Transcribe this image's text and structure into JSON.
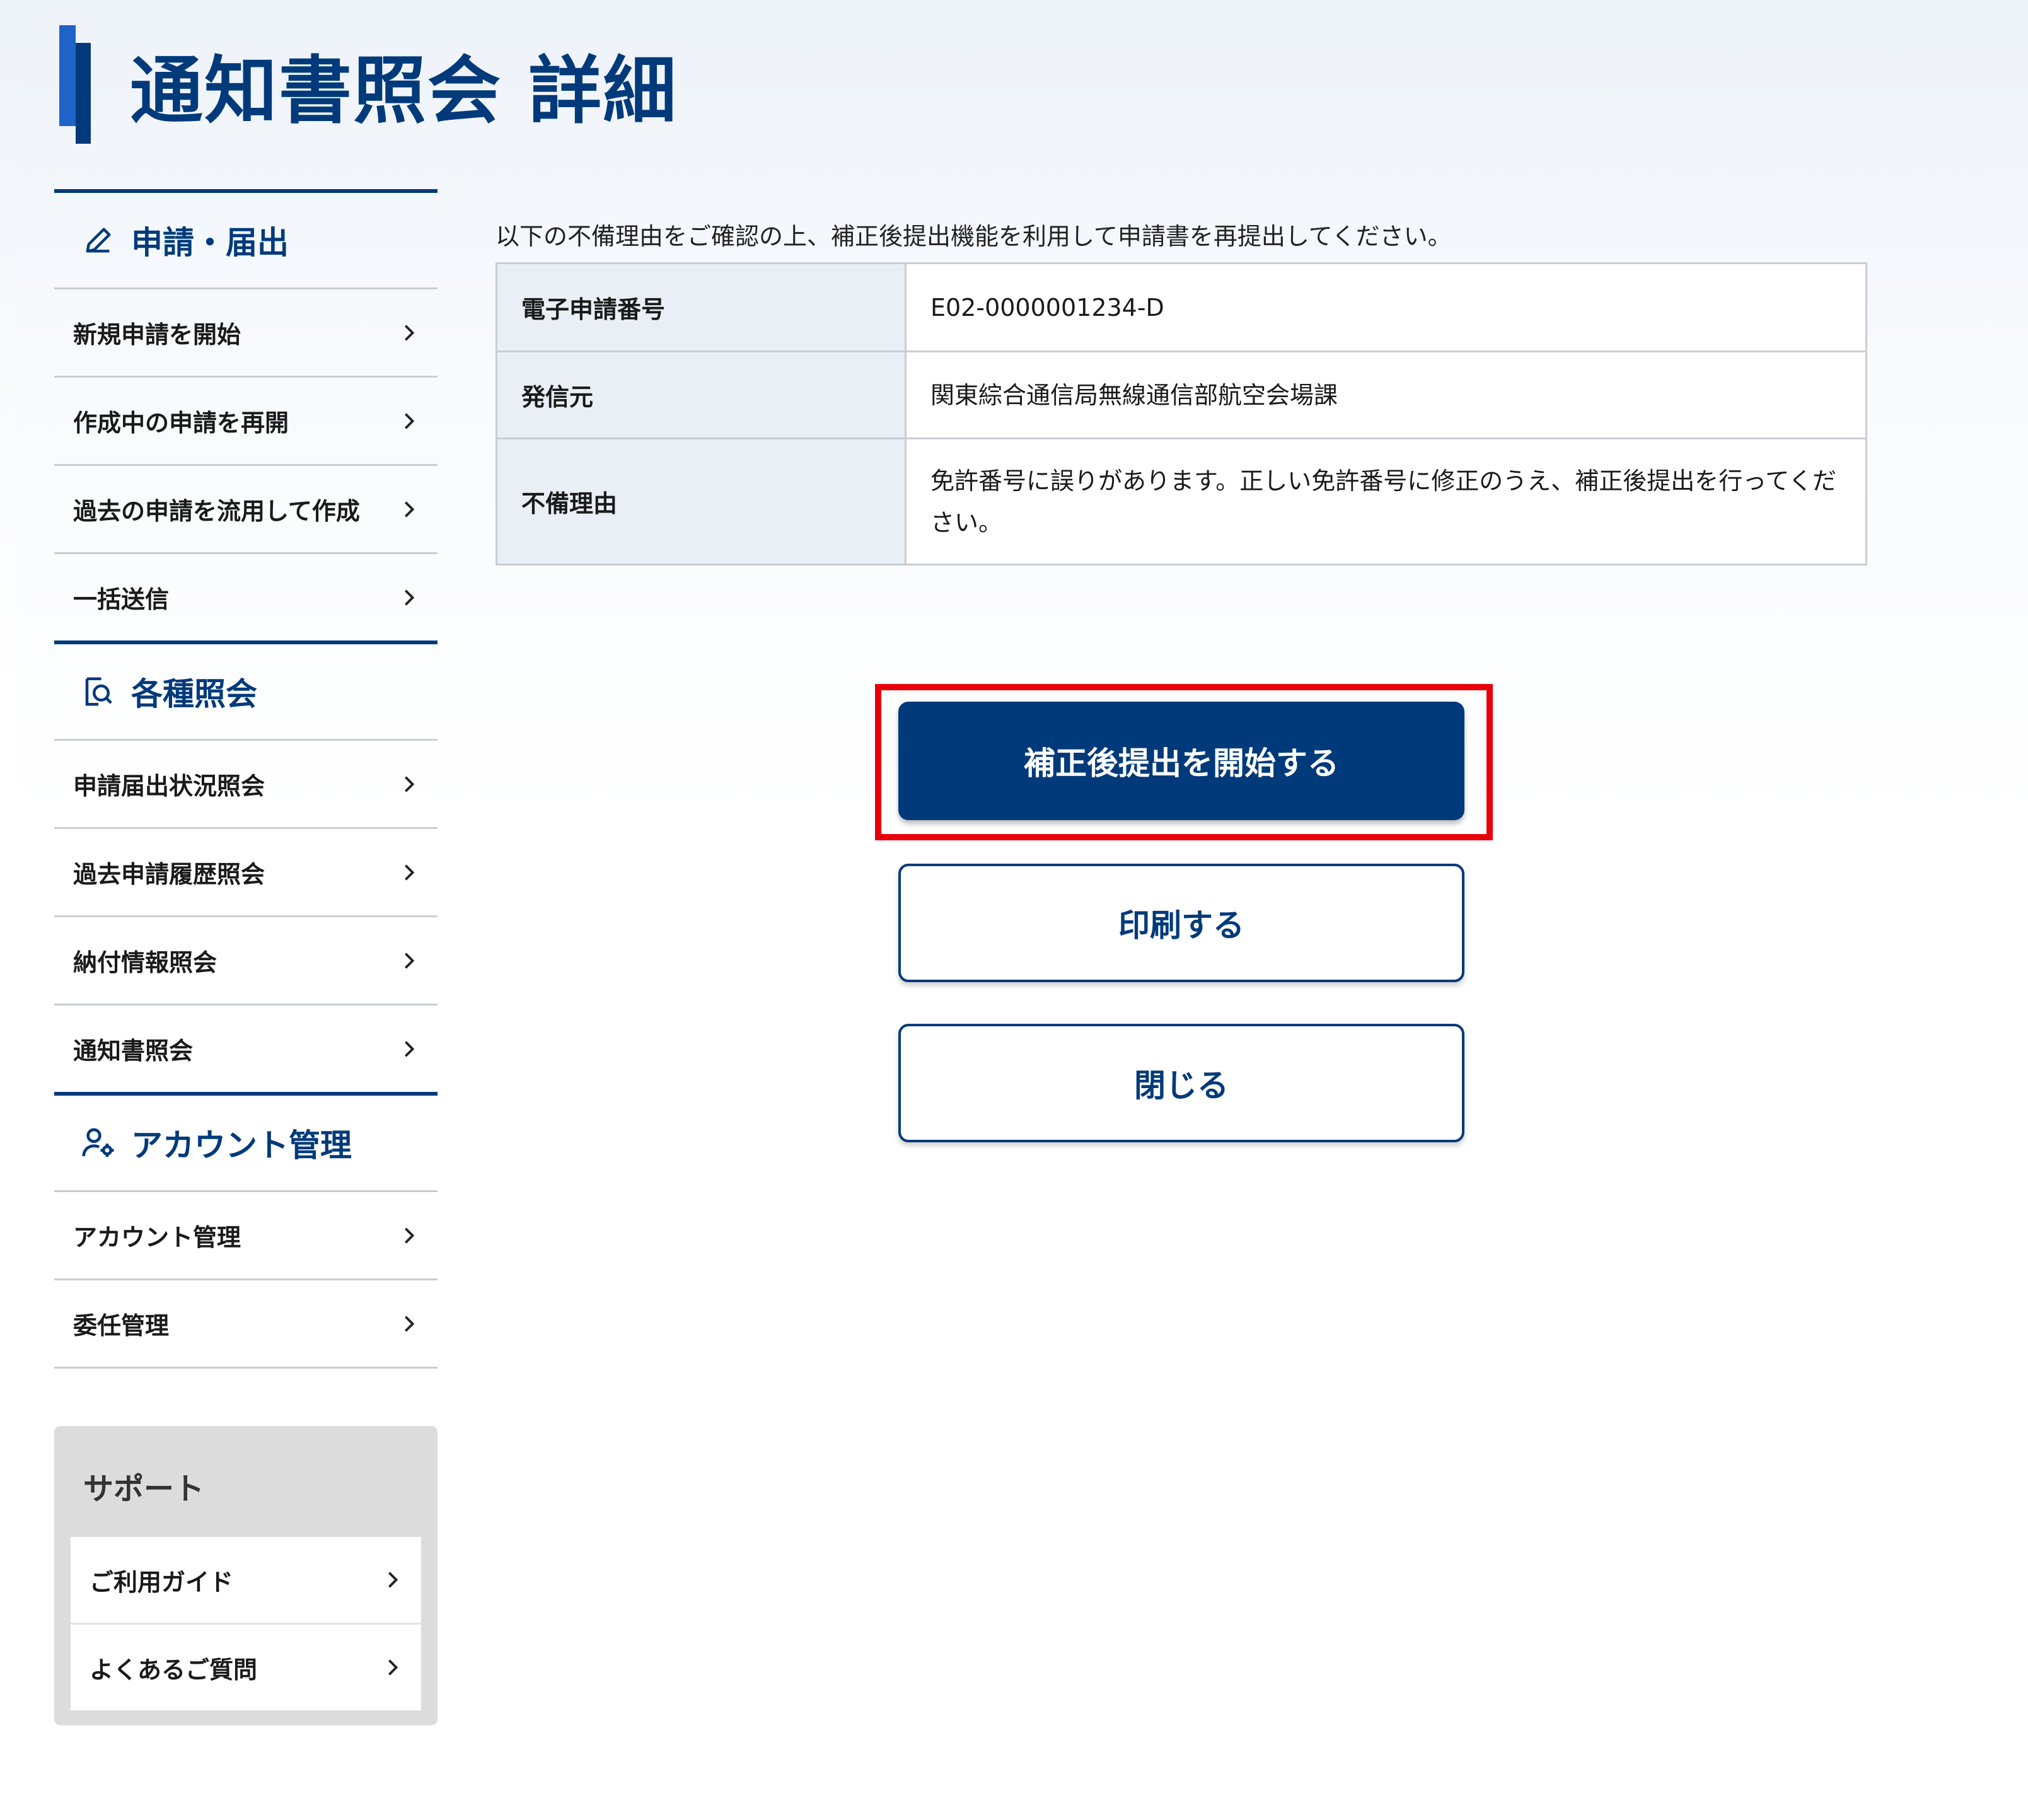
{
  "page": {
    "title": "通知書照会 詳細"
  },
  "sidebar": {
    "sections": [
      {
        "heading": "申請・届出",
        "icon": "pencil-icon",
        "items": [
          "新規申請を開始",
          "作成中の申請を再開",
          "過去の申請を流用して作成",
          "一括送信"
        ]
      },
      {
        "heading": "各種照会",
        "icon": "document-search-icon",
        "items": [
          "申請届出状況照会",
          "過去申請履歴照会",
          "納付情報照会",
          "通知書照会"
        ]
      },
      {
        "heading": "アカウント管理",
        "icon": "user-gear-icon",
        "items": [
          "アカウント管理",
          "委任管理"
        ]
      }
    ],
    "support": {
      "heading": "サポート",
      "items": [
        "ご利用ガイド",
        "よくあるご質問"
      ]
    }
  },
  "main": {
    "intro": "以下の不備理由をご確認の上、補正後提出機能を利用して申請書を再提出してください。",
    "table": [
      {
        "label": "電子申請番号",
        "value": "E02-0000001234-D"
      },
      {
        "label": "発信元",
        "value": "関東綜合通信局無線通信部航空会場課"
      },
      {
        "label": "不備理由",
        "value": "免許番号に誤りがあります。正しい免許番号に修正のうえ、補正後提出を行ってください。"
      }
    ],
    "buttons": {
      "start_correction": "補正後提出を開始する",
      "print": "印刷する",
      "close": "閉じる"
    }
  },
  "colors": {
    "brand": "#003a7a",
    "accent_light": "#1f63c9",
    "highlight": "#e8000b"
  }
}
